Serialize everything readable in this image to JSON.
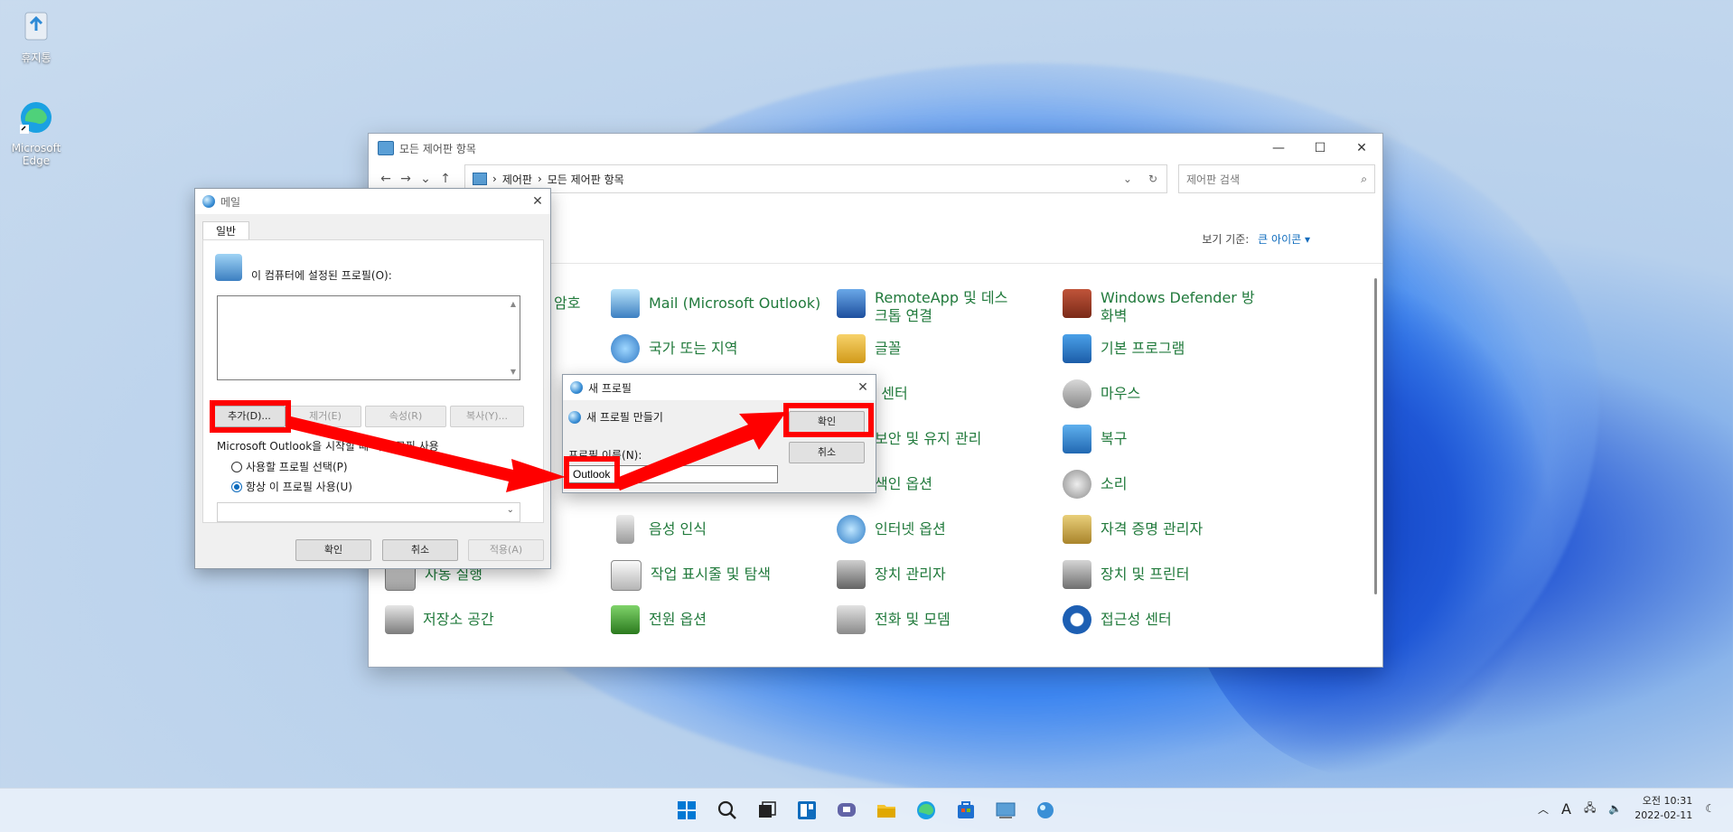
{
  "desktop": {
    "recycle_bin": "휴지통",
    "edge": "Microsoft Edge"
  },
  "control_panel": {
    "title": "모든 제어판 항목",
    "breadcrumb": [
      "제어판",
      "모든 제어판 항목"
    ],
    "search_placeholder": "제어판 검색",
    "view_by_label": "보기 기준:",
    "view_by_value": "큰 아이콘 ▾",
    "items": [
      {
        "label": "암호",
        "color": "#217a3c"
      },
      {
        "label": "Mail (Microsoft Outlook)"
      },
      {
        "label": "RemoteApp 및 데스크톱 연결"
      },
      {
        "label": "Windows Defender 방화벽"
      },
      {
        "label": "국가 또는 지역"
      },
      {
        "label": "글꼴"
      },
      {
        "label": "기본 프로그램"
      },
      {
        "label": "동기화 센터"
      },
      {
        "label": "마우스"
      },
      {
        "label": "보안 및 유지 관리"
      },
      {
        "label": "복구"
      },
      {
        "label": "색인 옵션"
      },
      {
        "label": "소리"
      },
      {
        "label": "음성 인식"
      },
      {
        "label": "인터넷 옵션"
      },
      {
        "label": "자격 증명 관리자"
      },
      {
        "label": "자동 실행"
      },
      {
        "label": "작업 표시줄 및 탐색"
      },
      {
        "label": "장치 관리자"
      },
      {
        "label": "장치 및 프린터"
      },
      {
        "label": "저장소 공간"
      },
      {
        "label": "전원 옵션"
      },
      {
        "label": "전화 및 모뎀"
      },
      {
        "label": "접근성 센터"
      }
    ]
  },
  "mail_dialog": {
    "title": "메일",
    "tab": "일반",
    "profiles_label": "이 컴퓨터에 설정된 프로필(O):",
    "buttons": {
      "add": "추가(D)...",
      "remove": "제거(E)",
      "properties": "속성(R)",
      "copy": "복사(Y)..."
    },
    "startup_label": "Microsoft Outlook을 시작할 때 이 프로필 사용",
    "radio_prompt": "사용할 프로필 선택(P)",
    "radio_always": "항상 이 프로필 사용(U)",
    "ok": "확인",
    "cancel": "취소",
    "apply": "적용(A)"
  },
  "new_profile_dialog": {
    "title": "새 프로필",
    "subtitle": "새 프로필 만들기",
    "name_label": "프로필 이름(N):",
    "name_value": "Outlook",
    "ok": "확인",
    "cancel": "취소"
  },
  "taskbar": {
    "time": "오전 10:31",
    "date": "2022-02-11",
    "lang": "A"
  }
}
